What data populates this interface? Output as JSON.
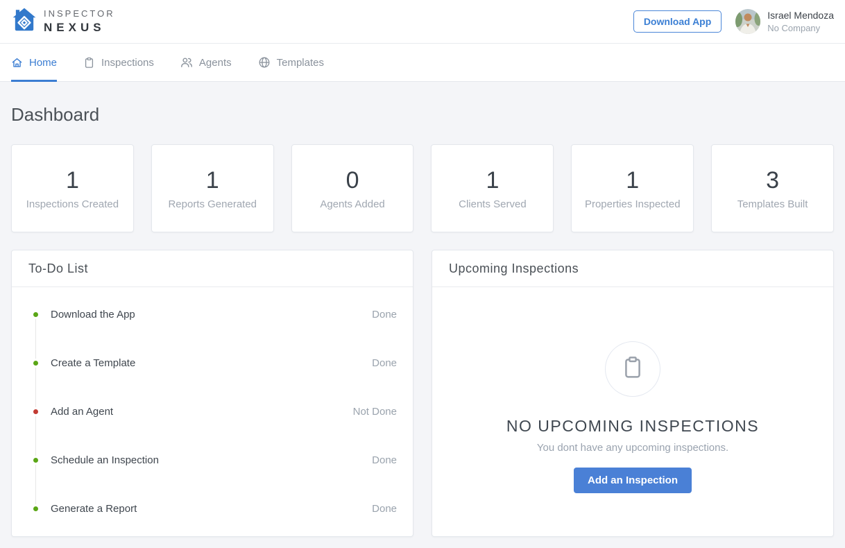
{
  "brand": {
    "logo_icon": "house-diamond-icon",
    "line1": "INSPECTOR",
    "line2": "NEXUS"
  },
  "header": {
    "download_button_label": "Download App",
    "user": {
      "name": "Israel Mendoza",
      "company": "No Company"
    }
  },
  "nav": {
    "items": [
      {
        "label": "Home",
        "icon": "home-icon",
        "active": true
      },
      {
        "label": "Inspections",
        "icon": "clipboard-icon",
        "active": false
      },
      {
        "label": "Agents",
        "icon": "people-icon",
        "active": false
      },
      {
        "label": "Templates",
        "icon": "globe-icon",
        "active": false
      }
    ]
  },
  "page_title": "Dashboard",
  "stats": [
    {
      "value": "1",
      "label": "Inspections Created"
    },
    {
      "value": "1",
      "label": "Reports Generated"
    },
    {
      "value": "0",
      "label": "Agents Added"
    },
    {
      "value": "1",
      "label": "Clients Served"
    },
    {
      "value": "1",
      "label": "Properties Inspected"
    },
    {
      "value": "3",
      "label": "Templates Built"
    }
  ],
  "todo": {
    "title": "To-Do List",
    "items": [
      {
        "label": "Download the App",
        "status": "Done",
        "state": "done"
      },
      {
        "label": "Create a Template",
        "status": "Done",
        "state": "done"
      },
      {
        "label": "Add an Agent",
        "status": "Not Done",
        "state": "not_done"
      },
      {
        "label": "Schedule an Inspection",
        "status": "Done",
        "state": "done"
      },
      {
        "label": "Generate a Report",
        "status": "Done",
        "state": "done"
      }
    ]
  },
  "upcoming": {
    "title": "Upcoming Inspections",
    "empty_icon": "clipboard-icon",
    "empty_title": "NO UPCOMING INSPECTIONS",
    "empty_subtitle": "You dont have any upcoming inspections.",
    "button_label": "Add an Inspection"
  },
  "colors": {
    "primary_blue": "#3b7dd2",
    "button_blue": "#4a80d6",
    "done_green": "#5aa616",
    "not_done_red": "#c23b33",
    "page_background": "#f4f5f8"
  }
}
